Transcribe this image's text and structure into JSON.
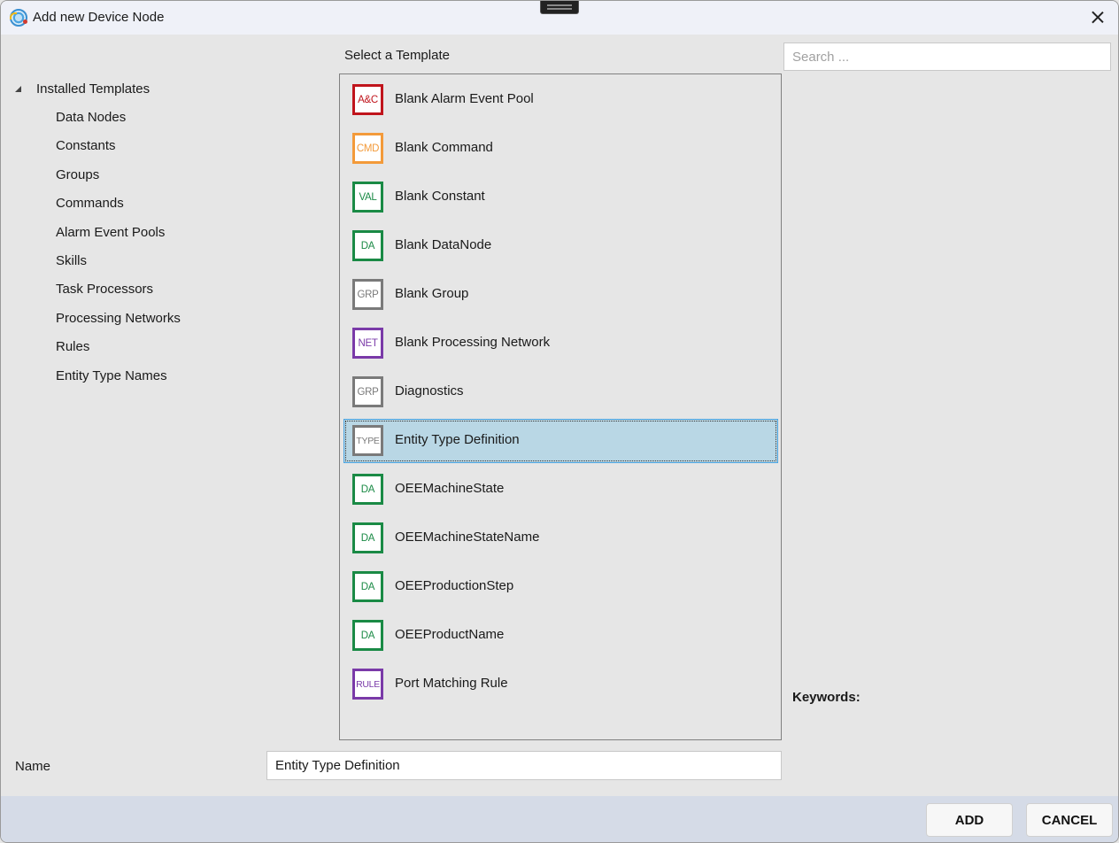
{
  "window": {
    "title": "Add new Device Node"
  },
  "tree": {
    "root_label": "Installed Templates",
    "items": [
      {
        "label": "Data Nodes"
      },
      {
        "label": "Constants"
      },
      {
        "label": "Groups"
      },
      {
        "label": "Commands"
      },
      {
        "label": "Alarm Event Pools"
      },
      {
        "label": "Skills"
      },
      {
        "label": "Task Processors"
      },
      {
        "label": "Processing Networks"
      },
      {
        "label": "Rules"
      },
      {
        "label": "Entity Type Names"
      }
    ]
  },
  "templates": {
    "header": "Select a Template",
    "selected_index": 7,
    "items": [
      {
        "badge": "A&C",
        "label": "Blank Alarm Event Pool",
        "color": "#c0141c",
        "icon": "alarm-event-pool-icon"
      },
      {
        "badge": "CMD",
        "label": "Blank Command",
        "color": "#f39a3a",
        "icon": "command-icon"
      },
      {
        "badge": "VAL",
        "label": "Blank Constant",
        "color": "#1a8a45",
        "icon": "constant-icon"
      },
      {
        "badge": "DA",
        "label": "Blank DataNode",
        "color": "#1a8a45",
        "icon": "datanode-icon"
      },
      {
        "badge": "GRP",
        "label": "Blank Group",
        "color": "#7a7a7a",
        "icon": "group-icon"
      },
      {
        "badge": "NET",
        "label": "Blank Processing Network",
        "color": "#7a3aa8",
        "icon": "processing-network-icon"
      },
      {
        "badge": "GRP",
        "label": "Diagnostics",
        "color": "#7a7a7a",
        "icon": "group-icon"
      },
      {
        "badge": "TYPE",
        "label": "Entity Type Definition",
        "color": "#7a7a7a",
        "icon": "type-icon"
      },
      {
        "badge": "DA",
        "label": "OEEMachineState",
        "color": "#1a8a45",
        "icon": "datanode-icon"
      },
      {
        "badge": "DA",
        "label": "OEEMachineStateName",
        "color": "#1a8a45",
        "icon": "datanode-icon"
      },
      {
        "badge": "DA",
        "label": "OEEProductionStep",
        "color": "#1a8a45",
        "icon": "datanode-icon"
      },
      {
        "badge": "DA",
        "label": "OEEProductName",
        "color": "#1a8a45",
        "icon": "datanode-icon"
      },
      {
        "badge": "RULE",
        "label": "Port Matching Rule",
        "color": "#7a3aa8",
        "icon": "rule-icon"
      }
    ]
  },
  "search": {
    "placeholder": "Search ...",
    "value": ""
  },
  "details": {
    "keywords_label": "Keywords:"
  },
  "name_field": {
    "label": "Name",
    "value": "Entity Type Definition"
  },
  "footer": {
    "add_label": "ADD",
    "cancel_label": "CANCEL"
  }
}
